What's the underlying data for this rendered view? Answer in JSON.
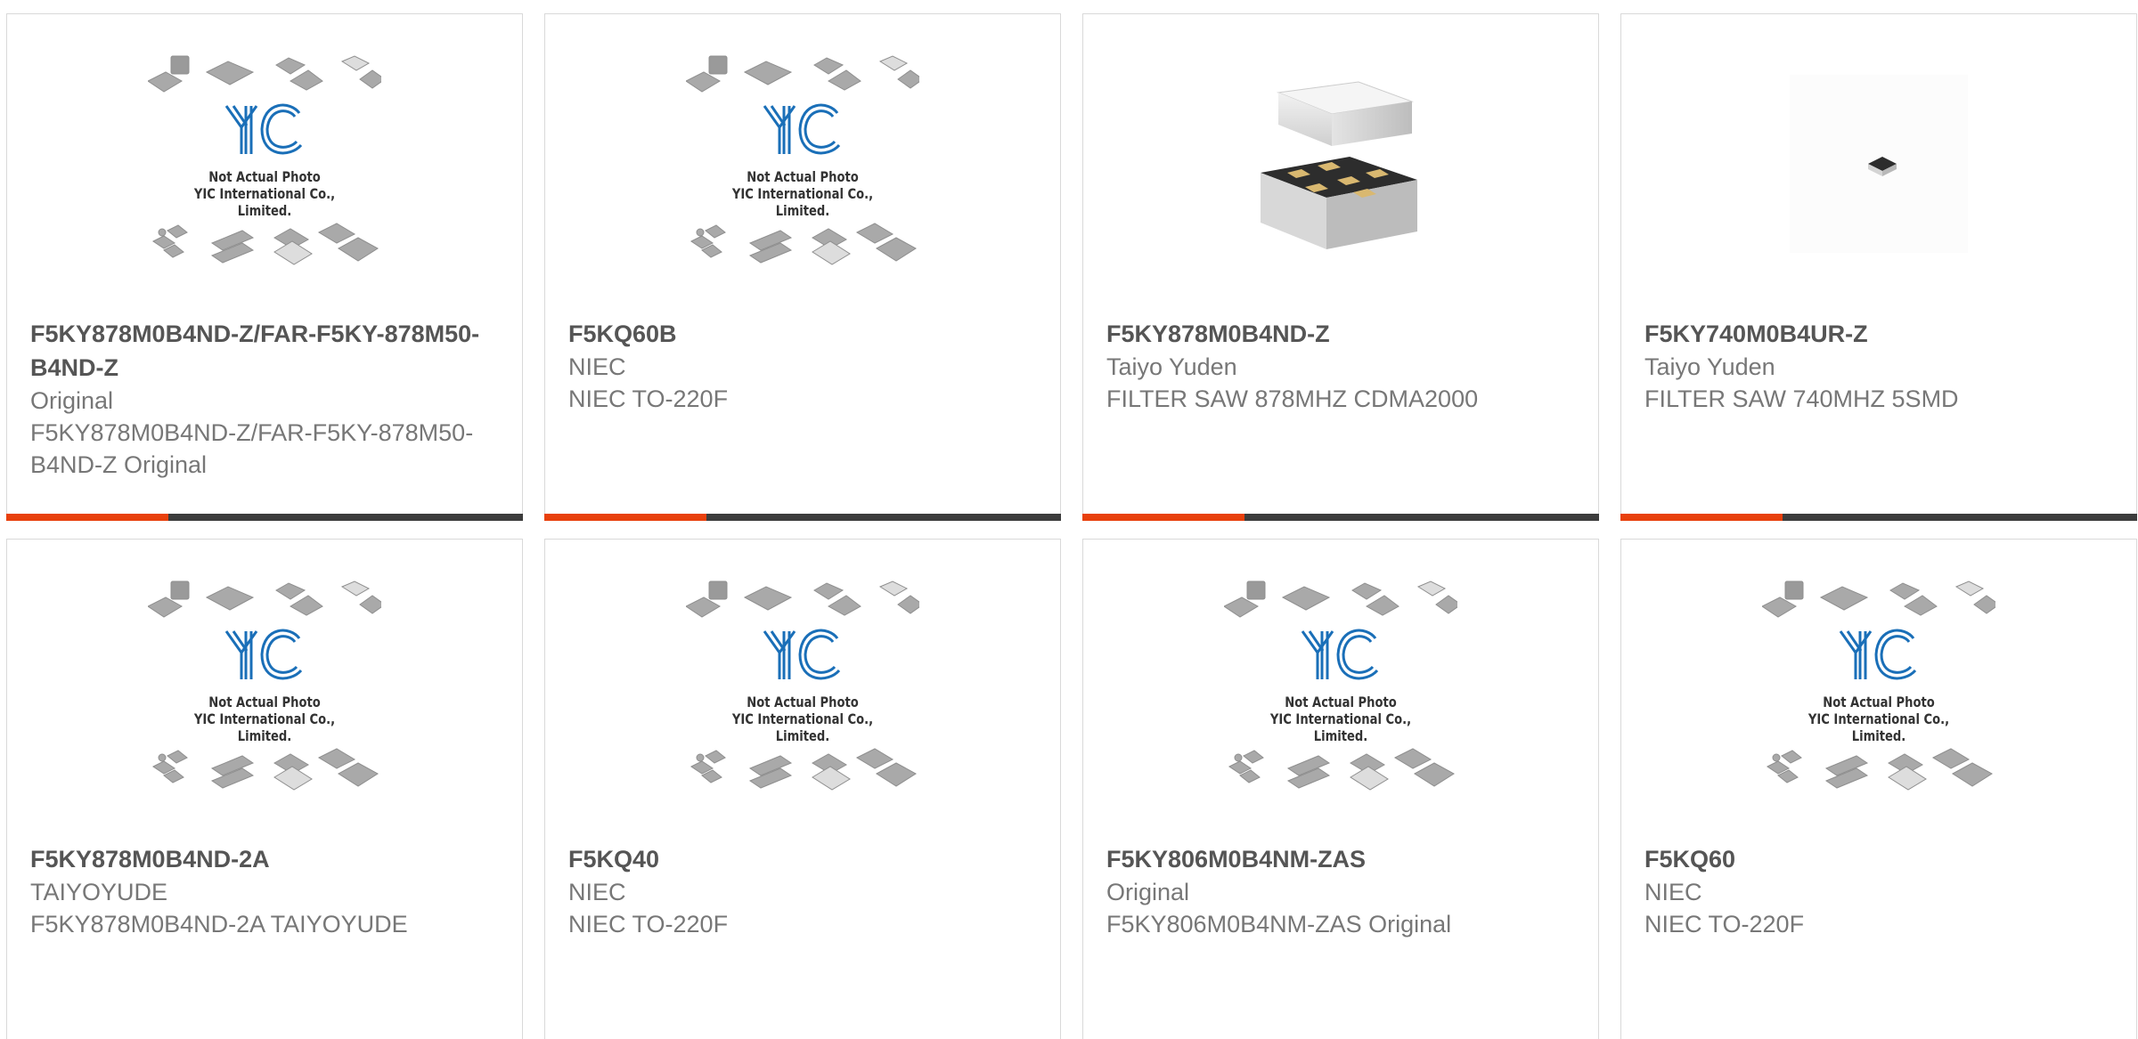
{
  "placeholder": {
    "logo_text": "YIC",
    "line1": "Not Actual Photo",
    "line2": "YIC International Co., Limited."
  },
  "products": [
    {
      "part": "F5KY878M0B4ND-Z/FAR-F5KY-878M50-B4ND-Z",
      "brand": "Original",
      "desc": "F5KY878M0B4ND-Z/FAR-F5KY-878M50-B4ND-Z Original",
      "image": "placeholder"
    },
    {
      "part": "F5KQ60B",
      "brand": "NIEC",
      "desc": "NIEC TO-220F",
      "image": "placeholder"
    },
    {
      "part": "F5KY878M0B4ND-Z",
      "brand": "Taiyo Yuden",
      "desc": "FILTER SAW 878MHZ CDMA2000",
      "image": "saw-filter-large"
    },
    {
      "part": "F5KY740M0B4UR-Z",
      "brand": "Taiyo Yuden",
      "desc": "FILTER SAW 740MHZ 5SMD",
      "image": "saw-filter-small"
    },
    {
      "part": "F5KY878M0B4ND-2A",
      "brand": "TAIYOYUDE",
      "desc": "F5KY878M0B4ND-2A TAIYOYUDE",
      "image": "placeholder"
    },
    {
      "part": "F5KQ40",
      "brand": "NIEC",
      "desc": "NIEC TO-220F",
      "image": "placeholder"
    },
    {
      "part": "F5KY806M0B4NM-ZAS",
      "brand": "Original",
      "desc": "F5KY806M0B4NM-ZAS Original",
      "image": "placeholder"
    },
    {
      "part": "F5KQ60",
      "brand": "NIEC",
      "desc": "NIEC TO-220F",
      "image": "placeholder"
    }
  ],
  "colors": {
    "accent": "#e8400c",
    "bar": "#3c3c3c",
    "logo": "#1a6fb8"
  }
}
